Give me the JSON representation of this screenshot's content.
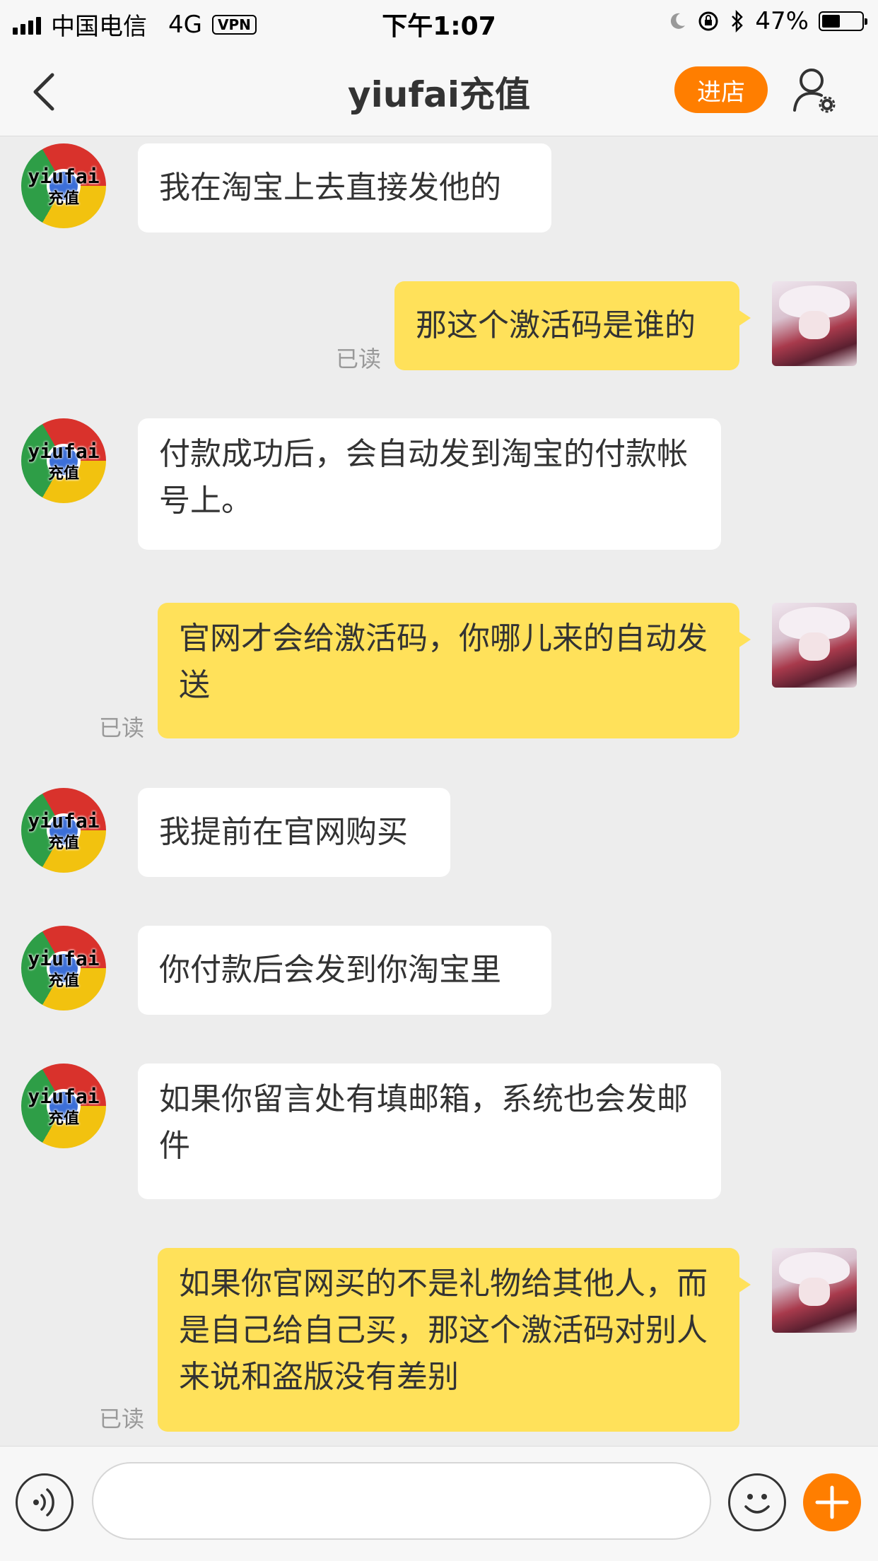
{
  "status_bar": {
    "carrier": "中国电信",
    "network": "4G",
    "vpn": "VPN",
    "time": "下午1:07",
    "battery_text": "47%",
    "battery_level": 0.47
  },
  "nav": {
    "title": "yiufai充值",
    "store_button": "进店"
  },
  "shop_avatar": {
    "line1": "yiufai",
    "line2": "充值"
  },
  "messages": [
    {
      "side": "left",
      "text": "我在淘宝上去直接发他的"
    },
    {
      "side": "right",
      "text": "那这个激活码是谁的",
      "read": "已读"
    },
    {
      "side": "left",
      "text": "付款成功后，会自动发到淘宝的付款帐号上。"
    },
    {
      "side": "right",
      "text": "官网才会给激活码，你哪儿来的自动发送",
      "read": "已读"
    },
    {
      "side": "left",
      "text": "我提前在官网购买"
    },
    {
      "side": "left",
      "text": "你付款后会发到你淘宝里"
    },
    {
      "side": "left",
      "text": "如果你留言处有填邮箱，系统也会发邮件"
    },
    {
      "side": "right",
      "text": "如果你官网买的不是礼物给其他人，而是自己给自己买，那这个激活码对别人来说和盗版没有差别",
      "read": "已读"
    }
  ],
  "input": {
    "value": "",
    "placeholder": ""
  }
}
